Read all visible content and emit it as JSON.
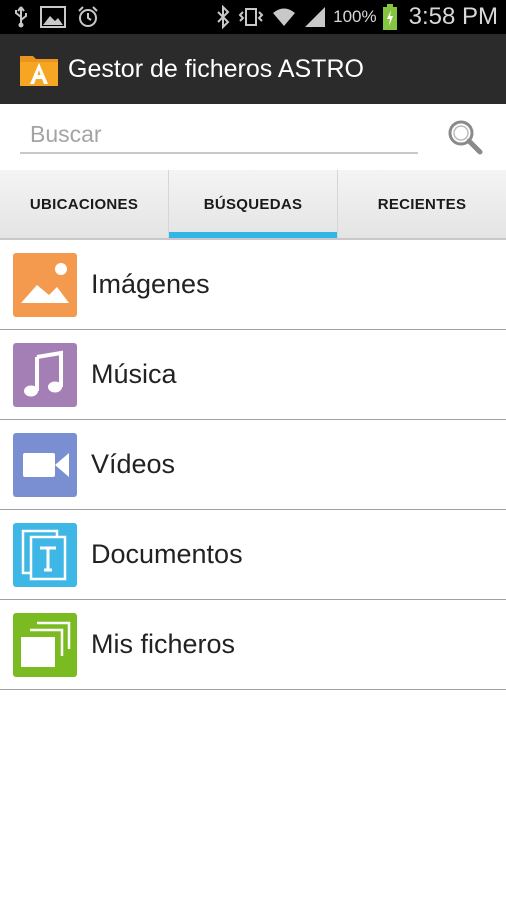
{
  "status_bar": {
    "battery_percent": "100%",
    "time": "3:58 PM",
    "icons": [
      "usb-icon",
      "image-icon",
      "alarm-icon",
      "bluetooth-icon",
      "vibrate-icon",
      "wifi-icon",
      "signal-icon",
      "battery-charging-icon"
    ]
  },
  "app": {
    "title": "Gestor de ficheros ASTRO",
    "icon": "astro-folder-icon"
  },
  "search": {
    "placeholder": "Buscar",
    "value": "",
    "icon": "search-icon"
  },
  "tabs": [
    {
      "label": "UBICACIONES",
      "active": false
    },
    {
      "label": "BÚSQUEDAS",
      "active": true
    },
    {
      "label": "RECIENTES",
      "active": false
    }
  ],
  "colors": {
    "accent": "#33b5e5",
    "action_bar": "#2b2b2b",
    "images": "#f39a4e",
    "music": "#a47fb5",
    "videos": "#7a8fd1",
    "documents": "#3fb7e6",
    "my_files": "#7bbb22"
  },
  "list": {
    "items": [
      {
        "label": "Imágenes",
        "icon": "image-icon"
      },
      {
        "label": "Música",
        "icon": "music-note-icon"
      },
      {
        "label": "Vídeos",
        "icon": "video-camera-icon"
      },
      {
        "label": "Documentos",
        "icon": "document-icon"
      },
      {
        "label": "Mis ficheros",
        "icon": "files-stack-icon"
      }
    ]
  }
}
